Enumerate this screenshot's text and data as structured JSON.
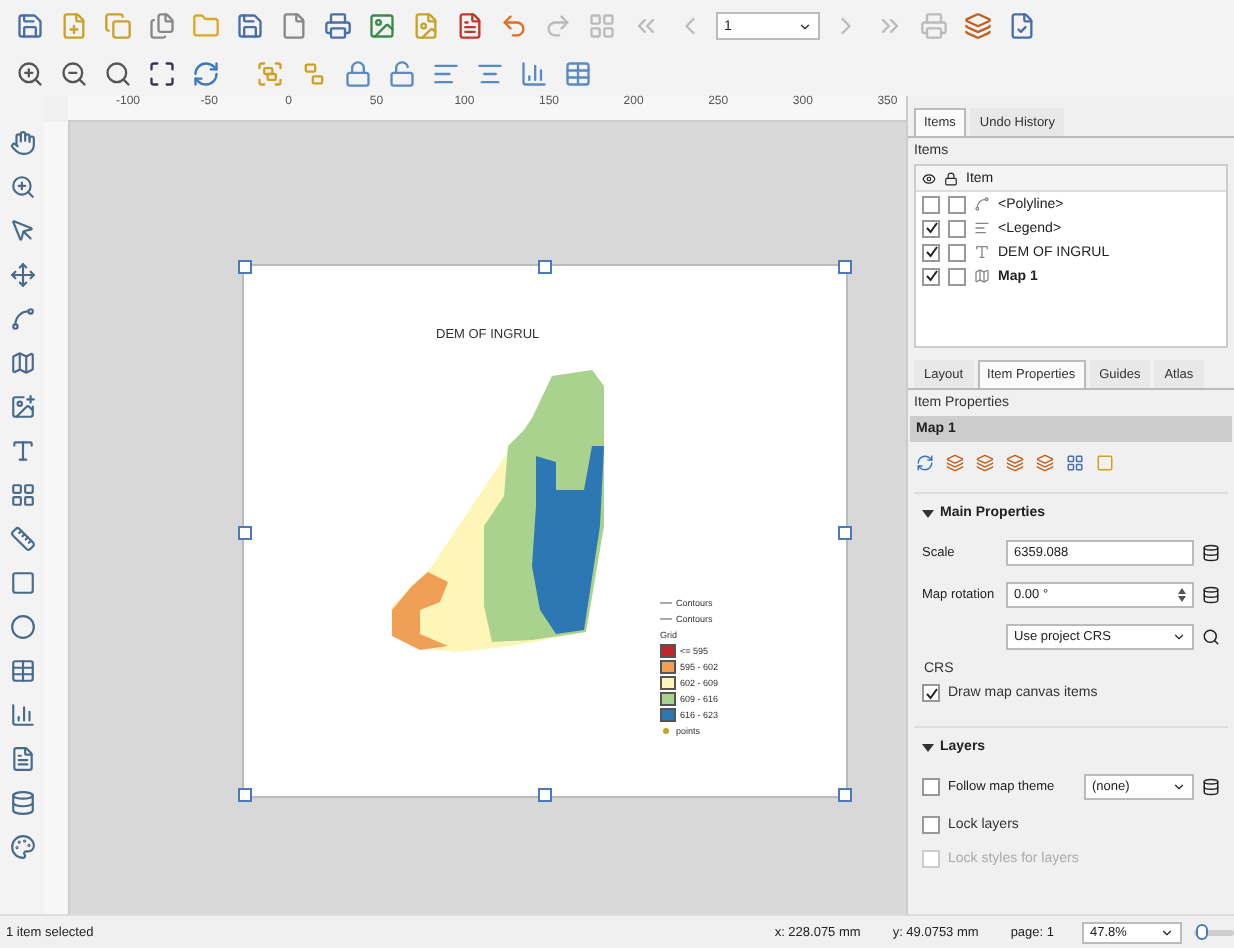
{
  "toolbar": {
    "page_field": "1"
  },
  "ruler": {
    "labels": [
      "-100",
      "-50",
      "0",
      "50",
      "100",
      "150",
      "200",
      "250",
      "300",
      "350"
    ]
  },
  "layout_page": {
    "title": "DEM OF INGRUL",
    "legend": [
      {
        "kind": "line",
        "label": "Contours"
      },
      {
        "kind": "line",
        "label": "Contours"
      },
      {
        "kind": "heading",
        "label": "Grid"
      },
      {
        "kind": "swatch",
        "label": "<= 595",
        "color": "#c0262c"
      },
      {
        "kind": "swatch",
        "label": "595 - 602",
        "color": "#f0a055"
      },
      {
        "kind": "swatch",
        "label": "602 - 609",
        "color": "#fdf6b8"
      },
      {
        "kind": "swatch",
        "label": "609 - 616",
        "color": "#a8d28e"
      },
      {
        "kind": "swatch",
        "label": "616 - 623",
        "color": "#2d78b4"
      },
      {
        "kind": "point",
        "label": "points"
      }
    ]
  },
  "items_panel": {
    "tabs": [
      {
        "label": "Items",
        "selected": true
      },
      {
        "label": "Undo History",
        "selected": false
      }
    ],
    "label": "Items",
    "header": "Item",
    "rows": [
      {
        "kind": "polyline",
        "name": "<Polyline>",
        "visible": false,
        "locked": false,
        "selected": false
      },
      {
        "kind": "legend",
        "name": "<Legend>",
        "visible": true,
        "locked": false,
        "selected": false
      },
      {
        "kind": "label",
        "name": "DEM OF INGRUL",
        "visible": true,
        "locked": false,
        "selected": false
      },
      {
        "kind": "map",
        "name": "Map 1",
        "visible": true,
        "locked": false,
        "selected": true
      }
    ]
  },
  "properties_panel": {
    "tabs": [
      {
        "label": "Layout",
        "selected": false
      },
      {
        "label": "Item Properties",
        "selected": true
      },
      {
        "label": "Guides",
        "selected": false
      },
      {
        "label": "Atlas",
        "selected": false
      }
    ],
    "label": "Item Properties",
    "item_name": "Map 1",
    "main_properties": {
      "title": "Main Properties",
      "expanded": true,
      "scale_label": "Scale",
      "scale_value": "6359.088",
      "rotation_label": "Map rotation",
      "rotation_value": "0.00 °",
      "crs_dropdown": "Use project CRS",
      "crs_label": "CRS",
      "draw_canvas_items": {
        "label": "Draw map canvas items",
        "checked": true
      }
    },
    "layers": {
      "title": "Layers",
      "expanded": true,
      "follow_theme": {
        "label": "Follow map theme",
        "checked": false
      },
      "theme_dropdown": "(none)",
      "lock_layers": {
        "label": "Lock layers",
        "checked": false
      },
      "lock_styles": {
        "label": "Lock styles for layers",
        "checked": false,
        "disabled": true
      }
    }
  },
  "status_bar": {
    "message": "1 item selected",
    "x": "x: 228.075 mm",
    "y": "y: 49.0753 mm",
    "page": "page: 1",
    "zoom": "47.8%",
    "zoom_slider": {
      "level": 0.05
    }
  }
}
